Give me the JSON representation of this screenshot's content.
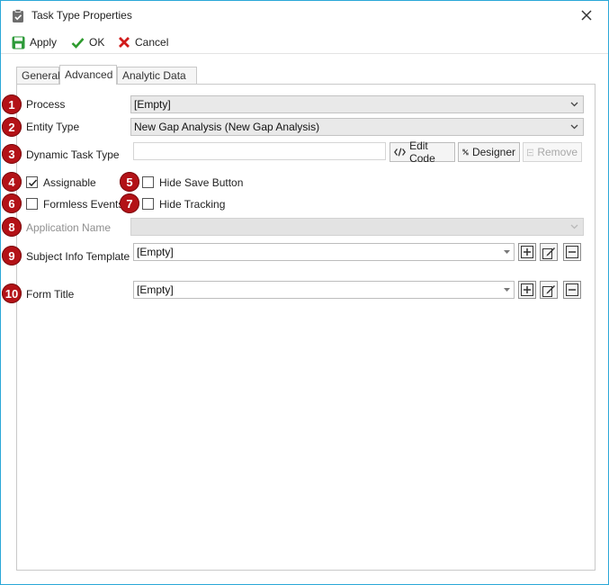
{
  "window": {
    "title": "Task Type Properties"
  },
  "toolbar": {
    "apply": "Apply",
    "ok": "OK",
    "cancel": "Cancel"
  },
  "tabs": [
    {
      "label": "General",
      "active": false
    },
    {
      "label": "Advanced",
      "active": true
    },
    {
      "label": "Analytic Data",
      "active": false
    }
  ],
  "badges": [
    "1",
    "2",
    "3",
    "4",
    "5",
    "6",
    "7",
    "8",
    "9",
    "10"
  ],
  "fields": {
    "process": {
      "label": "Process",
      "value": "[Empty]"
    },
    "entity_type": {
      "label": "Entity Type",
      "value": "New Gap Analysis (New Gap Analysis)"
    },
    "dynamic_task_type": {
      "label": "Dynamic Task Type",
      "value": "",
      "edit_code": "Edit Code",
      "designer": "Designer",
      "remove": "Remove"
    },
    "assignable": {
      "label": "Assignable",
      "checked": true
    },
    "hide_save_button": {
      "label": "Hide Save Button",
      "checked": false
    },
    "formless_events": {
      "label": "Formless Events",
      "checked": false
    },
    "hide_tracking": {
      "label": "Hide Tracking",
      "checked": false
    },
    "application_name": {
      "label": "Application Name",
      "value": ""
    },
    "subject_info_template": {
      "label": "Subject Info Template",
      "value": "[Empty]"
    },
    "form_title": {
      "label": "Form Title",
      "value": "[Empty]"
    }
  },
  "colors": {
    "badge": "#b31217",
    "border": "#2aa7d8",
    "ok_green": "#2e9b2e",
    "cancel_red": "#d11b1b"
  }
}
